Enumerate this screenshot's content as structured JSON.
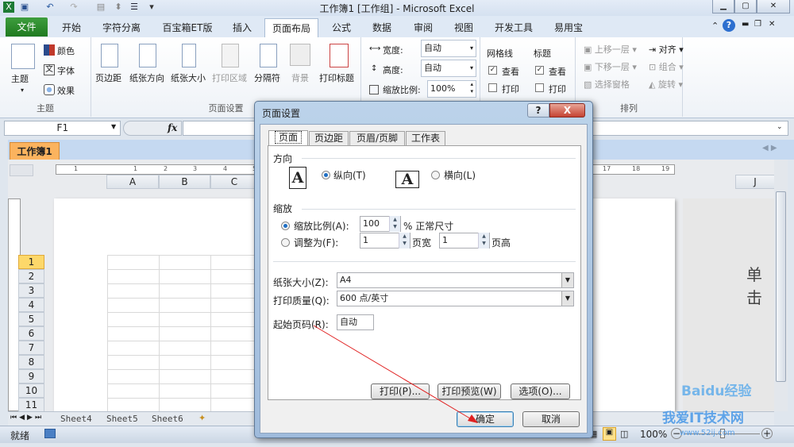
{
  "window": {
    "title": "工作簿1  [工作组]  -  Microsoft Excel"
  },
  "ribbon_tabs": [
    "文件",
    "开始",
    "字符分离",
    "百宝箱ET版",
    "插入",
    "页面布局",
    "公式",
    "数据",
    "审阅",
    "视图",
    "开发工具",
    "易用宝"
  ],
  "ribbon": {
    "theme": {
      "group": "主题",
      "themes": "主题",
      "colors": "颜色",
      "fonts": "字体",
      "effects": "效果"
    },
    "page_setup": {
      "group": "页面设置",
      "margins": "页边距",
      "orientation": "纸张方向",
      "size": "纸张大小",
      "print_area": "打印区域",
      "breaks": "分隔符",
      "background": "背景",
      "print_titles": "打印标题"
    },
    "scale": {
      "width_label": "宽度:",
      "width_value": "自动",
      "height_label": "高度:",
      "height_value": "自动",
      "scale_label": "缩放比例:",
      "scale_value": "100%"
    },
    "sheet_options": {
      "gridlines": "网格线",
      "headings": "标题",
      "view": "查看",
      "print": "打印"
    },
    "arrange": {
      "group": "排列",
      "bring_forward": "上移一层",
      "send_backward": "下移一层",
      "selection_pane": "选择窗格",
      "align": "对齐",
      "group_btn": "组合",
      "rotate": "旋转"
    }
  },
  "formula_bar": {
    "name_box": "F1",
    "fx": "fx",
    "value": ""
  },
  "workbook_tab": "工作簿1",
  "ruler": {
    "top": [
      "1",
      "1",
      "2",
      "3",
      "4",
      "5",
      "17",
      "18",
      "19"
    ]
  },
  "columns": [
    "A",
    "B",
    "C",
    "J"
  ],
  "rows": [
    "1",
    "2",
    "3",
    "4",
    "5",
    "6",
    "7",
    "8",
    "9",
    "10",
    "11"
  ],
  "page2_hint": "单击",
  "sheets": [
    "Sheet4",
    "Sheet5",
    "Sheet6"
  ],
  "status": {
    "ready": "就绪",
    "zoom": "100%"
  },
  "dialog": {
    "title": "页面设置",
    "help": "?",
    "close": "X",
    "tabs": [
      "页面",
      "页边距",
      "页眉/页脚",
      "工作表"
    ],
    "orientation": {
      "label": "方向",
      "portrait": "纵向(T)",
      "landscape": "横向(L)",
      "selected": "portrait",
      "icon_letter": "A"
    },
    "scaling": {
      "label": "缩放",
      "adjust_to_label": "缩放比例(A):",
      "adjust_to_value": "100",
      "adjust_to_suffix": "% 正常尺寸",
      "fit_to_label": "调整为(F):",
      "fit_wide": "1",
      "wide_suffix": "页宽",
      "fit_tall": "1",
      "tall_suffix": "页高",
      "selected": "adjust_to"
    },
    "paper_size_label": "纸张大小(Z):",
    "paper_size": "A4",
    "print_quality_label": "打印质量(Q):",
    "print_quality": "600 点/英寸",
    "first_page_label": "起始页码(R):",
    "first_page": "自动",
    "print_btn": "打印(P)...",
    "preview_btn": "打印预览(W)",
    "options_btn": "选项(O)...",
    "ok": "确定",
    "cancel": "取消"
  },
  "watermark": {
    "text1": "Baidu经验",
    "text2": "我爱IT技术网",
    "url": "www.52ij.com"
  }
}
